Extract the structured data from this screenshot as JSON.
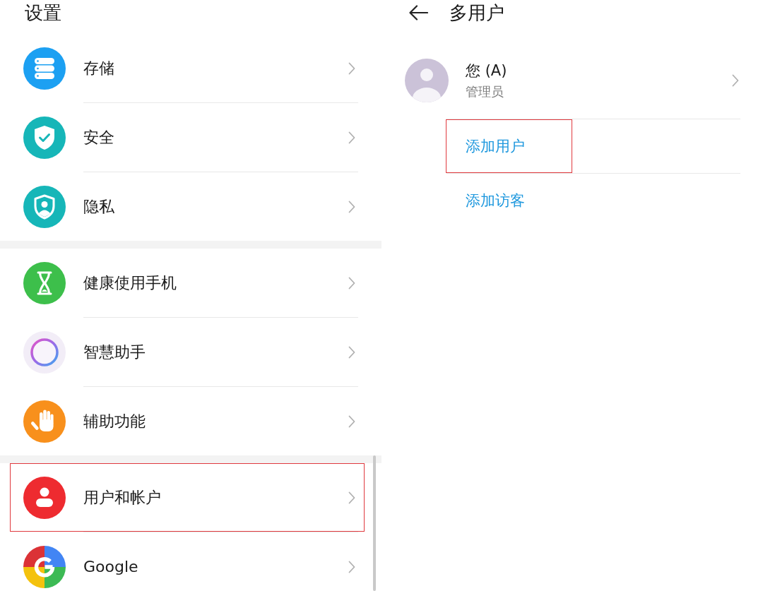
{
  "settings": {
    "title": "设置",
    "groups": [
      {
        "items": [
          {
            "kind": "storage",
            "label": "存储",
            "highlighted": false
          },
          {
            "kind": "security",
            "label": "安全",
            "highlighted": false
          },
          {
            "kind": "privacy",
            "label": "隐私",
            "highlighted": false
          }
        ]
      },
      {
        "items": [
          {
            "kind": "health",
            "label": "健康使用手机",
            "highlighted": false
          },
          {
            "kind": "assistant",
            "label": "智慧助手",
            "highlighted": false
          },
          {
            "kind": "accessibility",
            "label": "辅助功能",
            "highlighted": false
          }
        ]
      },
      {
        "items": [
          {
            "kind": "account",
            "label": "用户和帐户",
            "highlighted": true
          },
          {
            "kind": "google",
            "label": "Google",
            "highlighted": false
          }
        ]
      }
    ]
  },
  "multi_user": {
    "title": "多用户",
    "user": {
      "name": "您 (A)",
      "role": "管理员"
    },
    "actions": [
      {
        "label": "添加用户",
        "highlighted": true
      },
      {
        "label": "添加访客",
        "highlighted": false
      }
    ]
  }
}
